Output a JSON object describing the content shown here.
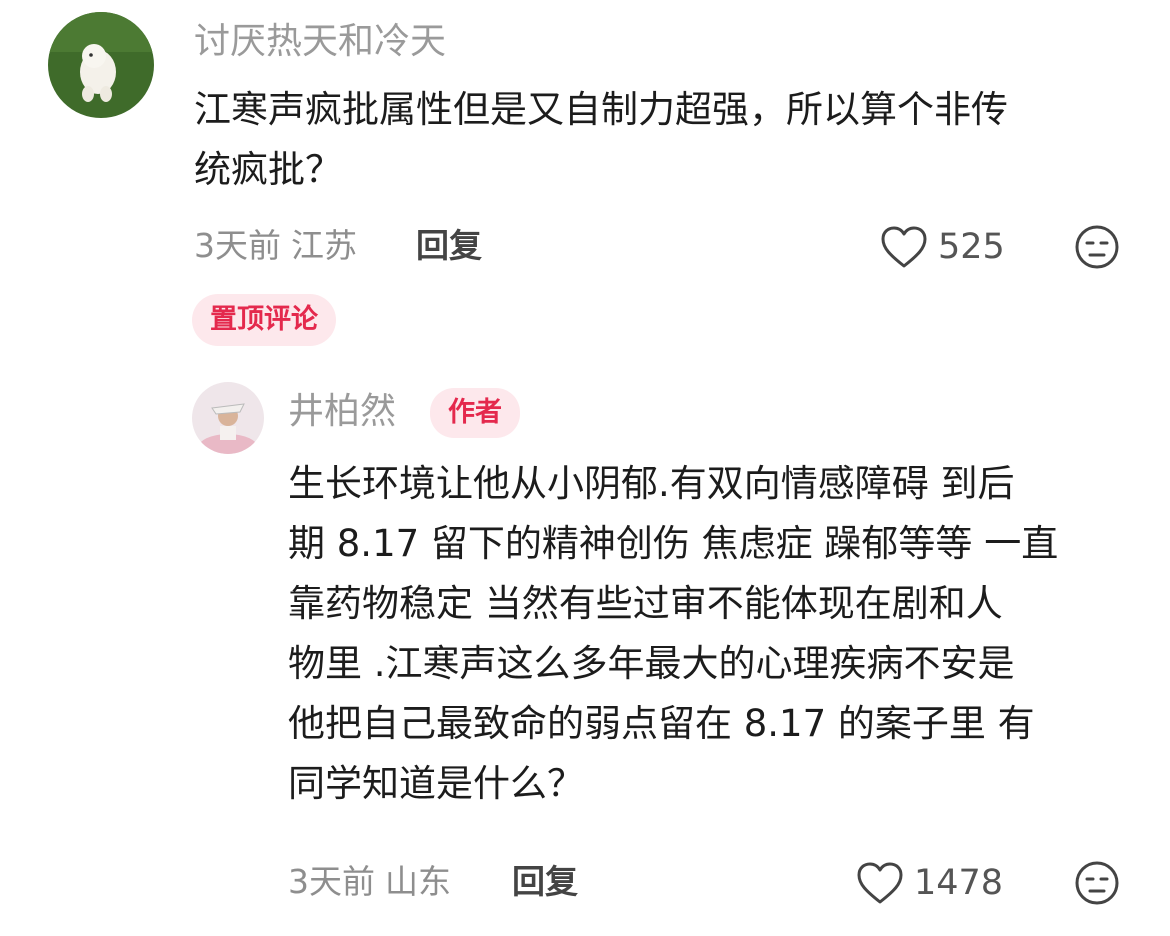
{
  "comment": {
    "username": "讨厌热天和冷天",
    "lines": [
      "江寒声疯批属性但是又自制力超强，所以算个非传",
      "统疯批？"
    ],
    "time": "3天前",
    "location": "江苏",
    "reply_label": "回复",
    "like_count": "525",
    "pinned_label": "置顶评论"
  },
  "reply": {
    "username": "井柏然",
    "badge": "作者",
    "lines": [
      "生长环境让他从小阴郁.有双向情感障碍 到后",
      "期 8.17 留下的精神创伤 焦虑症 躁郁等等 一直",
      "靠药物稳定 当然有些过审不能体现在剧和人",
      "物里 .江寒声这么多年最大的心理疾病不安是",
      "他把自己最致命的弱点留在 8.17 的案子里  有",
      "同学知道是什么？"
    ],
    "time": "3天前",
    "location": "山东",
    "reply_label": "回复",
    "like_count": "1478"
  },
  "icons": {
    "like": "heart-outline-icon",
    "dislike": "neutral-face-icon"
  },
  "colors": {
    "accent": "#e4294d",
    "badge_bg": "#fde8ec",
    "muted": "#9a9a9a"
  }
}
